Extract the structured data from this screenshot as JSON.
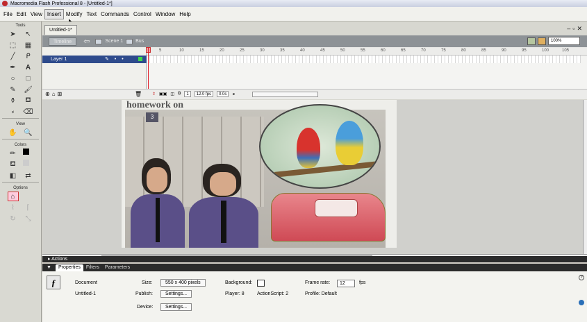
{
  "window": {
    "title": "Macromedia Flash Professional 8 - [Untitled-1*]"
  },
  "menu": [
    "File",
    "Edit",
    "View",
    "Insert",
    "Modify",
    "Text",
    "Commands",
    "Control",
    "Window",
    "Help"
  ],
  "tools": {
    "header": "Tools",
    "view": "View",
    "colors": "Colors",
    "options": "Options"
  },
  "document": {
    "tab": "Untitled-1*",
    "timeline_button": "Timeline",
    "scene": "Scene 1",
    "symbol": "Bus",
    "zoom": "100%"
  },
  "timeline": {
    "layer_name": "Layer 1",
    "frame_numbers": [
      "5",
      "10",
      "15",
      "20",
      "25",
      "30",
      "35",
      "40",
      "45",
      "50",
      "55",
      "60",
      "65",
      "70",
      "75",
      "80",
      "85",
      "90",
      "95",
      "100",
      "105"
    ],
    "current_frame": "1",
    "frame_rate": "12.0 fps",
    "elapsed": "0.0s"
  },
  "stage": {
    "heading": "homework on",
    "badge": "3"
  },
  "panels": {
    "actions": "Actions",
    "tabs": [
      "Properties",
      "Filters",
      "Parameters"
    ]
  },
  "properties": {
    "doc_label": "Document",
    "doc_name": "Untitled-1",
    "size_label": "Size:",
    "size_value": "550 x 400 pixels",
    "background_label": "Background:",
    "frame_rate_label": "Frame rate:",
    "frame_rate_value": "12",
    "fps_unit": "fps",
    "publish_label": "Publish:",
    "settings_label": "Settings...",
    "player_label": "Player: 8",
    "actionscript_label": "ActionScript: 2",
    "profile_label": "Profile: Default",
    "device_label": "Device:",
    "device_settings_label": "Settings..."
  }
}
